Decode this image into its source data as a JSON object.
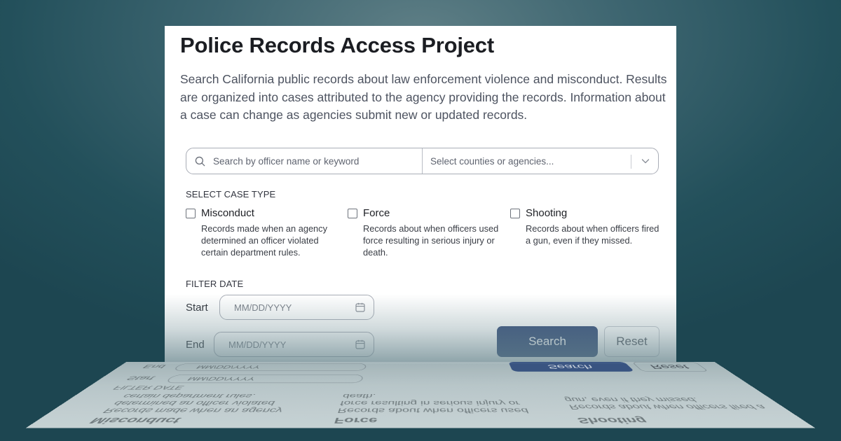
{
  "title": "Police Records Access Project",
  "intro": "Search California public records about law enforcement violence and misconduct. Results are organized into cases attributed to the agency providing the records. Information about a case can change as agencies submit new or updated records.",
  "search": {
    "keyword_placeholder": "Search by officer name or keyword",
    "agency_placeholder": "Select counties or agencies..."
  },
  "case_type": {
    "label": "SELECT CASE TYPE",
    "options": [
      {
        "name": "Misconduct",
        "description": "Records made when an agency determined an officer violated certain department rules."
      },
      {
        "name": "Force",
        "description": "Records about when officers used force resulting in serious injury or death."
      },
      {
        "name": "Shooting",
        "description": "Records about when officers fired a gun, even if they missed."
      }
    ]
  },
  "filter_date": {
    "label": "FILTER DATE",
    "start_label": "Start",
    "end_label": "End",
    "placeholder": "MM/DD/YYYY"
  },
  "actions": {
    "search_label": "Search",
    "reset_label": "Reset"
  },
  "colors": {
    "background": "#23505b",
    "search_button": "#2f4775",
    "title_text": "#1b1d22"
  },
  "icons": {
    "search": "magnifier",
    "dropdown": "chevron-down",
    "calendar": "calendar"
  }
}
